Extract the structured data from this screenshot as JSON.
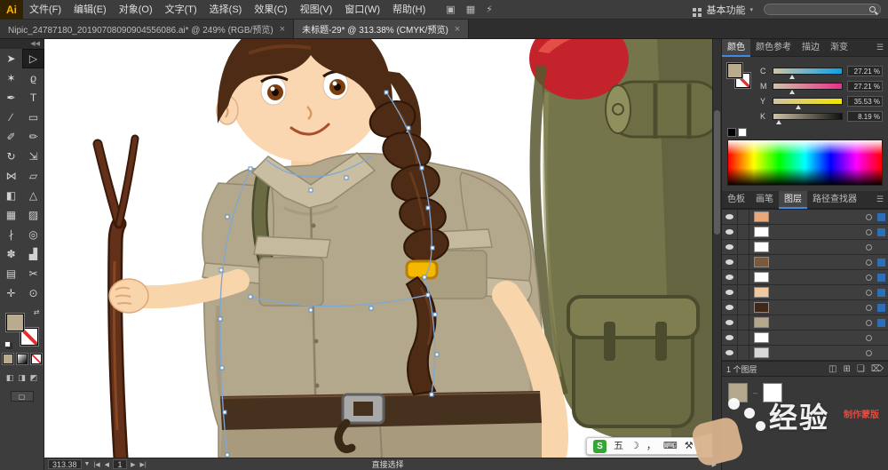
{
  "app": {
    "logo": "Ai",
    "workspace_label": "基本功能",
    "workspace_caret": "▾"
  },
  "menu": {
    "items": [
      "文件(F)",
      "编辑(E)",
      "对象(O)",
      "文字(T)",
      "选择(S)",
      "效果(C)",
      "视图(V)",
      "窗口(W)",
      "帮助(H)"
    ],
    "extra_icons": [
      "▣",
      "▦",
      "⚡"
    ]
  },
  "search": {
    "placeholder": ""
  },
  "tabs": [
    {
      "title": "Nipic_24787180_20190708090904556086.ai* @ 249% (RGB/预览)",
      "close": "×",
      "active": false
    },
    {
      "title": "未标题-29* @ 313.38% (CMYK/预览)",
      "close": "×",
      "active": true
    }
  ],
  "toolbar": {
    "collapse": "◀◀"
  },
  "tools": [
    {
      "name": "selection-tool",
      "glyph": "➤"
    },
    {
      "name": "direct-selection-tool",
      "glyph": "▷",
      "active": true
    },
    {
      "name": "magic-wand-tool",
      "glyph": "✶"
    },
    {
      "name": "lasso-tool",
      "glyph": "ϱ"
    },
    {
      "name": "pen-tool",
      "glyph": "✒"
    },
    {
      "name": "type-tool",
      "glyph": "T"
    },
    {
      "name": "line-segment-tool",
      "glyph": "∕"
    },
    {
      "name": "rectangle-tool",
      "glyph": "▭"
    },
    {
      "name": "paintbrush-tool",
      "glyph": "✐"
    },
    {
      "name": "pencil-tool",
      "glyph": "✏"
    },
    {
      "name": "rotate-tool",
      "glyph": "↻"
    },
    {
      "name": "scale-tool",
      "glyph": "⇲"
    },
    {
      "name": "width-tool",
      "glyph": "⋈"
    },
    {
      "name": "free-transform-tool",
      "glyph": "▱"
    },
    {
      "name": "shape-builder-tool",
      "glyph": "◧"
    },
    {
      "name": "perspective-grid-tool",
      "glyph": "△"
    },
    {
      "name": "mesh-tool",
      "glyph": "▦"
    },
    {
      "name": "gradient-tool",
      "glyph": "▨"
    },
    {
      "name": "eyedropper-tool",
      "glyph": "∤"
    },
    {
      "name": "blend-tool",
      "glyph": "◎"
    },
    {
      "name": "symbol-sprayer-tool",
      "glyph": "✽"
    },
    {
      "name": "column-graph-tool",
      "glyph": "▟"
    },
    {
      "name": "artboard-tool",
      "glyph": "▤"
    },
    {
      "name": "slice-tool",
      "glyph": "✂"
    },
    {
      "name": "hand-tool",
      "glyph": "✛"
    },
    {
      "name": "zoom-tool",
      "glyph": "⊙"
    }
  ],
  "color_panel": {
    "tabs": [
      {
        "label": "颜色",
        "active": true
      },
      {
        "label": "颜色参考",
        "active": false
      },
      {
        "label": "描边",
        "active": false
      },
      {
        "label": "渐变",
        "active": false
      }
    ],
    "menu_icon": "☰",
    "channels": [
      {
        "label": "C",
        "value": "27.21 %",
        "pct": 27
      },
      {
        "label": "M",
        "value": "27.21 %",
        "pct": 27
      },
      {
        "label": "Y",
        "value": "35.53 %",
        "pct": 36
      },
      {
        "label": "K",
        "value": "8.19 %",
        "pct": 8
      }
    ]
  },
  "panel2": {
    "tabs": [
      {
        "label": "色板",
        "active": false
      },
      {
        "label": "画笔",
        "active": false
      },
      {
        "label": "图层",
        "active": true
      },
      {
        "label": "路径查找器",
        "active": false
      }
    ]
  },
  "layers": {
    "rows": [
      {
        "thumb": "#e8a878",
        "selected": true
      },
      {
        "thumb": "#ffffff",
        "selected": true
      },
      {
        "thumb": "#ffffff",
        "selected": false
      },
      {
        "thumb": "#7a5a3a",
        "selected": true
      },
      {
        "thumb": "#ffffff",
        "selected": true
      },
      {
        "thumb": "#f0c9a0",
        "selected": true
      },
      {
        "thumb": "#402818",
        "selected": true
      },
      {
        "thumb": "#b3a78c",
        "selected": true
      },
      {
        "thumb": "#ffffff",
        "selected": false
      },
      {
        "thumb": "#d8d8d8",
        "selected": false
      }
    ],
    "footer": "1 个图层",
    "footer_icons": [
      {
        "name": "clipping-mask-icon",
        "glyph": "◫"
      },
      {
        "name": "new-sublayer-icon",
        "glyph": "⊞"
      },
      {
        "name": "new-layer-icon",
        "glyph": "❏"
      },
      {
        "name": "delete-layer-icon",
        "glyph": "⌦"
      }
    ]
  },
  "transparency": {
    "make_mask_label": "制作蒙版"
  },
  "status": {
    "zoom": "313.38",
    "zoom_caret": "▼",
    "nav_first": "|◀",
    "nav_prev": "◀",
    "artboard": "1",
    "nav_next": "▶",
    "nav_last": "▶|",
    "tool_name": "直接选择",
    "expand": "▶"
  },
  "ime": {
    "logo": "S",
    "items": [
      "五",
      "☽",
      "，",
      "⌨",
      "⚒"
    ]
  },
  "watermark": {
    "text": "经验"
  },
  "colors": {
    "accent": "#3f8ae0",
    "selection": "#2f6eb5",
    "mask_button_red": "#e8483b",
    "sogou_green": "#35a535",
    "fill_khaki": "#b9ac8e"
  }
}
